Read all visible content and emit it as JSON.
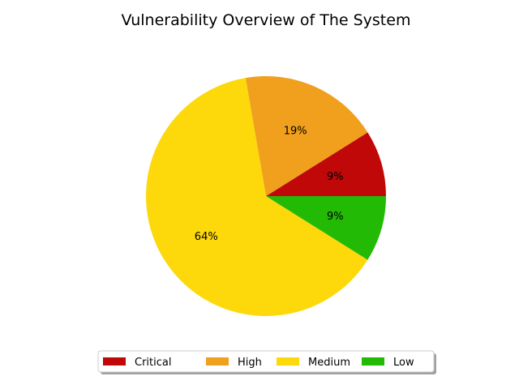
{
  "chart_data": {
    "type": "pie",
    "title": "Vulnerability Overview of The System",
    "categories": [
      "Critical",
      "High",
      "Medium",
      "Low"
    ],
    "values": [
      9,
      19,
      64,
      9
    ],
    "labels": [
      "9%",
      "19%",
      "64%",
      "9%"
    ],
    "colors": [
      "#c00808",
      "#f0a01c",
      "#fdd80a",
      "#22ba04"
    ],
    "start_angle_deg": 0,
    "direction": "counterclockwise",
    "legend": {
      "placement": "bottom-center",
      "columns": 4,
      "shadow": true
    }
  }
}
